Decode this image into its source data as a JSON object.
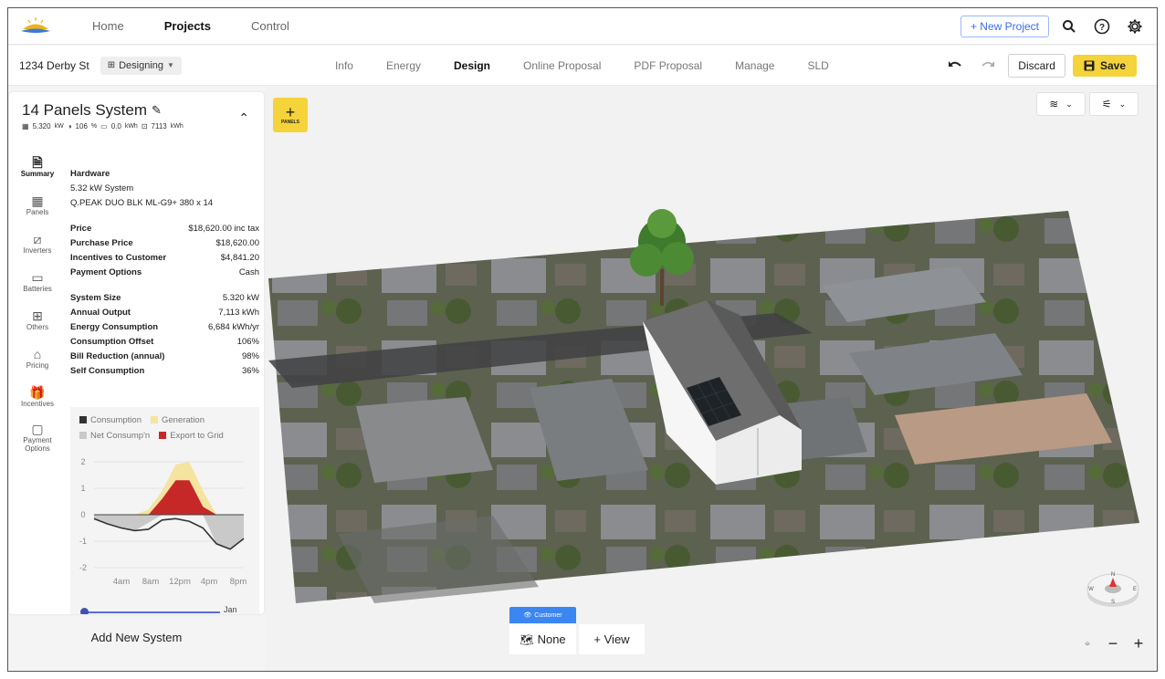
{
  "nav": {
    "items": [
      "Home",
      "Projects",
      "Control"
    ],
    "active": "Projects"
  },
  "header": {
    "new_project": "+ New Project"
  },
  "project": {
    "address": "1234 Derby St",
    "stage": "Designing"
  },
  "tabs": [
    "Info",
    "Energy",
    "Design",
    "Online Proposal",
    "PDF Proposal",
    "Manage",
    "SLD"
  ],
  "active_tab": "Design",
  "actions": {
    "discard": "Discard",
    "save": "Save"
  },
  "system": {
    "title": "14 Panels System",
    "kw": "5.320",
    "kw_unit": "kW",
    "offset": "106",
    "offset_unit": "%",
    "battery": "0.0",
    "battery_unit": "kWh",
    "output": "7113",
    "output_unit": "kWh"
  },
  "side_nav": [
    "Summary",
    "Panels",
    "Inverters",
    "Batteries",
    "Others",
    "Pricing",
    "Incentives",
    "Payment Options"
  ],
  "hardware": {
    "heading": "Hardware",
    "line1": "5.32 kW System",
    "line2": "Q.PEAK DUO BLK ML-G9+ 380 x 14"
  },
  "pricing": [
    {
      "label": "Price",
      "value": "$18,620.00 inc tax"
    },
    {
      "label": "Purchase Price",
      "value": "$18,620.00"
    },
    {
      "label": "Incentives to Customer",
      "value": "$4,841.20"
    },
    {
      "label": "Payment Options",
      "value": "Cash"
    }
  ],
  "stats": [
    {
      "label": "System Size",
      "value": "5.320 kW"
    },
    {
      "label": "Annual Output",
      "value": "7,113 kWh"
    },
    {
      "label": "Energy Consumption",
      "value": "6,684 kWh/yr"
    },
    {
      "label": "Consumption Offset",
      "value": "106%"
    },
    {
      "label": "Bill Reduction (annual)",
      "value": "98%"
    },
    {
      "label": "Self Consumption",
      "value": "36%"
    }
  ],
  "chart_data": {
    "type": "area",
    "series": [
      {
        "name": "Consumption",
        "color": "#333333",
        "values": [
          -0.15,
          -0.35,
          -0.5,
          -0.6,
          -0.55,
          -0.2,
          -0.15,
          -0.25,
          -0.5,
          -1.1,
          -1.3,
          -0.9
        ]
      },
      {
        "name": "Generation",
        "color": "#f5e3a0",
        "values": [
          0,
          0,
          0,
          0,
          0.2,
          0.9,
          1.9,
          2.0,
          0.9,
          0,
          0,
          0
        ]
      },
      {
        "name": "Net Consump'n",
        "color": "#c9c9c9",
        "values": [
          -0.15,
          -0.35,
          -0.5,
          -0.6,
          -0.3,
          0,
          0,
          0,
          0,
          -1.1,
          -1.3,
          -0.9
        ]
      },
      {
        "name": "Export to Grid",
        "color": "#c62828",
        "values": [
          0,
          0,
          0,
          0,
          0,
          0.6,
          1.3,
          1.3,
          0.3,
          0,
          0,
          0
        ]
      }
    ],
    "legend": [
      [
        "Consumption",
        "Generation"
      ],
      [
        "Net Consump'n",
        "Export to Grid"
      ]
    ],
    "y_ticks": [
      "2",
      "1",
      "0",
      "-1",
      "-2"
    ],
    "x_ticks": [
      "4am",
      "8am",
      "12pm",
      "4pm",
      "8pm"
    ],
    "ylim": [
      -2,
      2
    ],
    "month": "Jan"
  },
  "bottom": {
    "add_system": "Add New System",
    "customer": "Customer",
    "none": "None",
    "view": "+ View"
  },
  "panels_button": "PANELS"
}
